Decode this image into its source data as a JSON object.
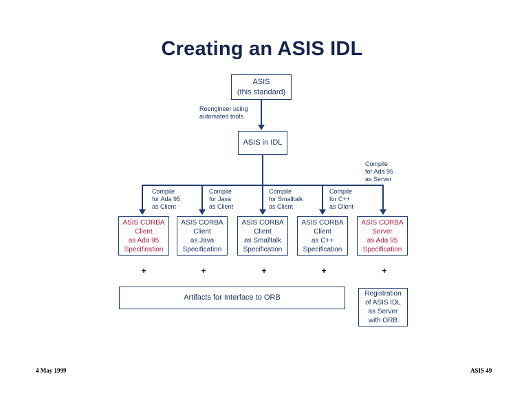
{
  "slide": {
    "title": "Creating an ASIS IDL",
    "colors": {
      "title": "#16244d",
      "box_border": "#1f3d73",
      "box_text": "#1b3464",
      "highlight_text": "#b01b46",
      "connector": "#1f3d73",
      "plus": "#000000",
      "background": "#ffffff"
    }
  },
  "source_box": {
    "line1": "ASIS",
    "line2": "(this standard)"
  },
  "transform_note": {
    "line1": "Reengineer using",
    "line2": "automated tools"
  },
  "idl_box": {
    "line1": "ASIS in IDL"
  },
  "server_compile_note": {
    "line1": "Compile",
    "line2": "for Ada 95",
    "line3": "as Server"
  },
  "compile_notes": [
    {
      "line1": "Compile",
      "line2": "for Ada 95",
      "line3": "as Client"
    },
    {
      "line1": "Compile",
      "line2": "for Java",
      "line3": "as Client"
    },
    {
      "line1": "Compile",
      "line2": "for Smalltalk",
      "line3": "as Client"
    },
    {
      "line1": "Compile",
      "line2": "for C++",
      "line3": "as Client"
    }
  ],
  "leaf_boxes": [
    {
      "line1": "ASIS CORBA",
      "line2": "Client",
      "line3": "as Ada 95",
      "line4": "Specification",
      "highlighted": true
    },
    {
      "line1": "ASIS CORBA",
      "line2": "Client",
      "line3": "as Java",
      "line4": "Specification",
      "highlighted": false
    },
    {
      "line1": "ASIS CORBA",
      "line2": "Client",
      "line3": "as Smalltalk",
      "line4": "Specification",
      "highlighted": false
    },
    {
      "line1": "ASIS CORBA",
      "line2": "Client",
      "line3": "as C++",
      "line4": "Specification",
      "highlighted": false
    },
    {
      "line1": "ASIS CORBA",
      "line2": "Server",
      "line3": "as Ada 95",
      "line4": "Specification",
      "highlighted": true
    }
  ],
  "plus_signs": [
    "+",
    "+",
    "+",
    "+",
    "+"
  ],
  "artifacts_box": {
    "line1": "Artifacts for Interface to ORB"
  },
  "registration_box": {
    "line1": "Registration",
    "line2": "of ASIS IDL",
    "line3": "as Server",
    "line4": "with ORB"
  },
  "footer": {
    "date": "4 May 1999",
    "page": "ASIS 49"
  }
}
